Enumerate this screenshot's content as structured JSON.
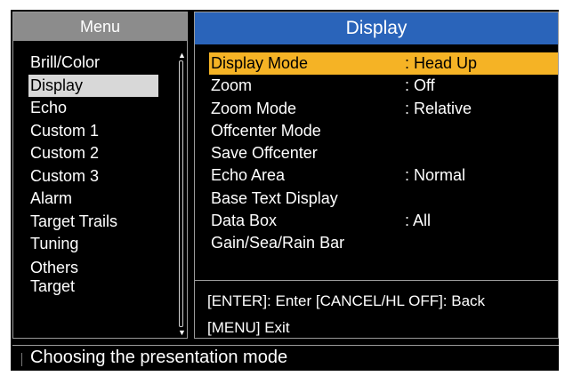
{
  "menu": {
    "title": "Menu",
    "items": [
      {
        "label": "Brill/Color"
      },
      {
        "label": "Display",
        "selected": true
      },
      {
        "label": "Echo"
      },
      {
        "label": "Custom 1"
      },
      {
        "label": "Custom 2"
      },
      {
        "label": "Custom 3"
      },
      {
        "label": "Alarm"
      },
      {
        "label": "Target Trails"
      },
      {
        "label": "Tuning"
      },
      {
        "label": "Others"
      },
      {
        "label": "Target"
      }
    ]
  },
  "display": {
    "title": "Display",
    "settings": [
      {
        "name": "Display Mode",
        "value": ": Head Up",
        "selected": true
      },
      {
        "name": "Zoom",
        "value": ": Off"
      },
      {
        "name": "Zoom Mode",
        "value": ": Relative"
      },
      {
        "name": "Offcenter Mode",
        "value": ""
      },
      {
        "name": "Save Offcenter",
        "value": ""
      },
      {
        "name": "Echo Area",
        "value": ": Normal"
      },
      {
        "name": "Base Text Display",
        "value": ""
      },
      {
        "name": "Data Box",
        "value": ": All"
      },
      {
        "name": "Gain/Sea/Rain Bar",
        "value": ""
      }
    ],
    "help_line1": "[ENTER]: Enter [CANCEL/HL OFF]: Back",
    "help_line2": "[MENU] Exit"
  },
  "status": {
    "text": "Choosing the presentation mode"
  },
  "colors": {
    "menu_header": "#8c8c8c",
    "display_header": "#2a64ba",
    "selected_setting": "#f5b325",
    "selected_menu": "#d8d8d8"
  }
}
